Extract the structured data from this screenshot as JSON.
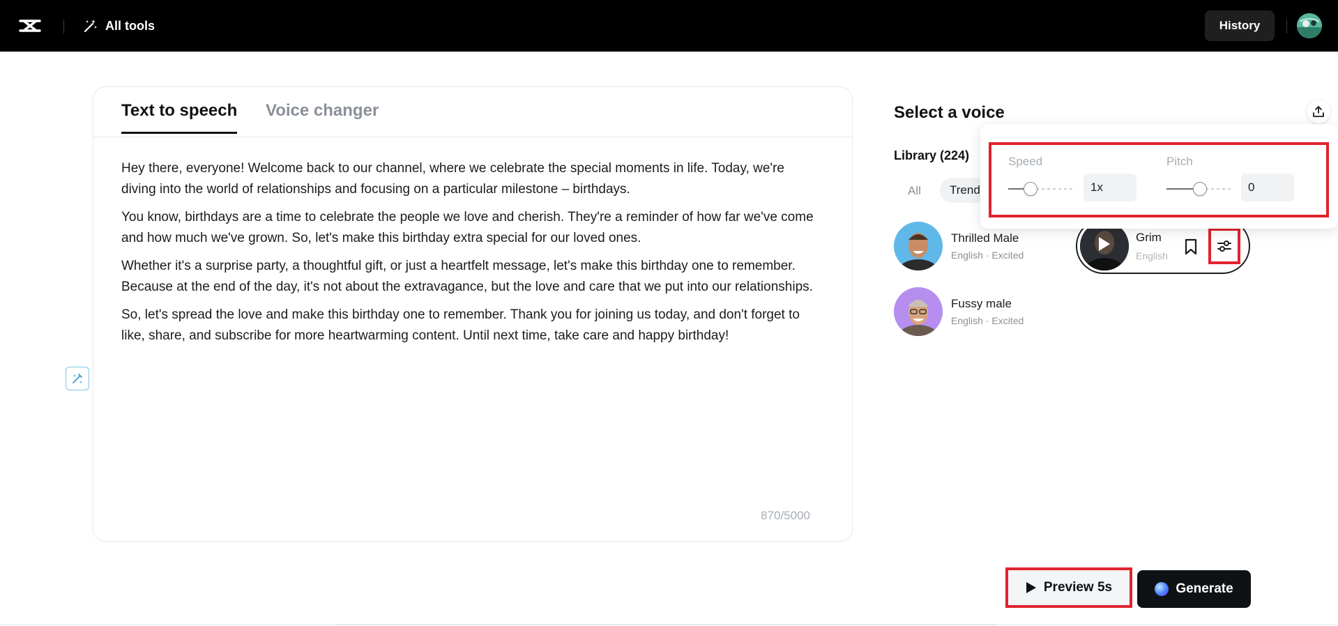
{
  "header": {
    "all_tools_label": "All tools",
    "history_label": "History"
  },
  "editor": {
    "tabs": [
      {
        "label": "Text to speech",
        "active": true
      },
      {
        "label": "Voice changer",
        "active": false
      }
    ],
    "paragraphs": [
      "Hey there, everyone! Welcome back to our channel, where we celebrate the special moments in life. Today, we're diving into the world of relationships and focusing on a particular milestone – birthdays.",
      "You know, birthdays are a time to celebrate the people we love and cherish. They're a reminder of how far we've come and how much we've grown. So, let's make this birthday extra special for our loved ones.",
      "Whether it's a surprise party, a thoughtful gift, or just a heartfelt message, let's make this birthday one to remember. Because at the end of the day, it's not about the extravagance, but the love and care that we put into our relationships.",
      "So, let's spread the love and make this birthday one to remember. Thank you for joining us today, and don't forget to like, share, and subscribe for more heartwarming content. Until next time, take care and happy birthday!"
    ],
    "char_count": "870/5000"
  },
  "voice_panel": {
    "title": "Select a voice",
    "library_label": "Library (224)",
    "filters": [
      "All",
      "Trending"
    ],
    "voices": [
      {
        "name": "Thrilled Male",
        "meta": "English · Excited"
      },
      {
        "name": "Grim",
        "meta": "English"
      },
      {
        "name": "Fussy male",
        "meta": "English · Excited"
      }
    ],
    "settings": {
      "speed_label": "Speed",
      "speed_value": "1x",
      "speed_level": 0.33,
      "pitch_label": "Pitch",
      "pitch_value": "0",
      "pitch_level": 0.5
    }
  },
  "actions": {
    "preview_label": "Preview 5s",
    "generate_label": "Generate"
  },
  "colors": {
    "accent_highlight": "#e0232e",
    "topbar": "#000000"
  }
}
